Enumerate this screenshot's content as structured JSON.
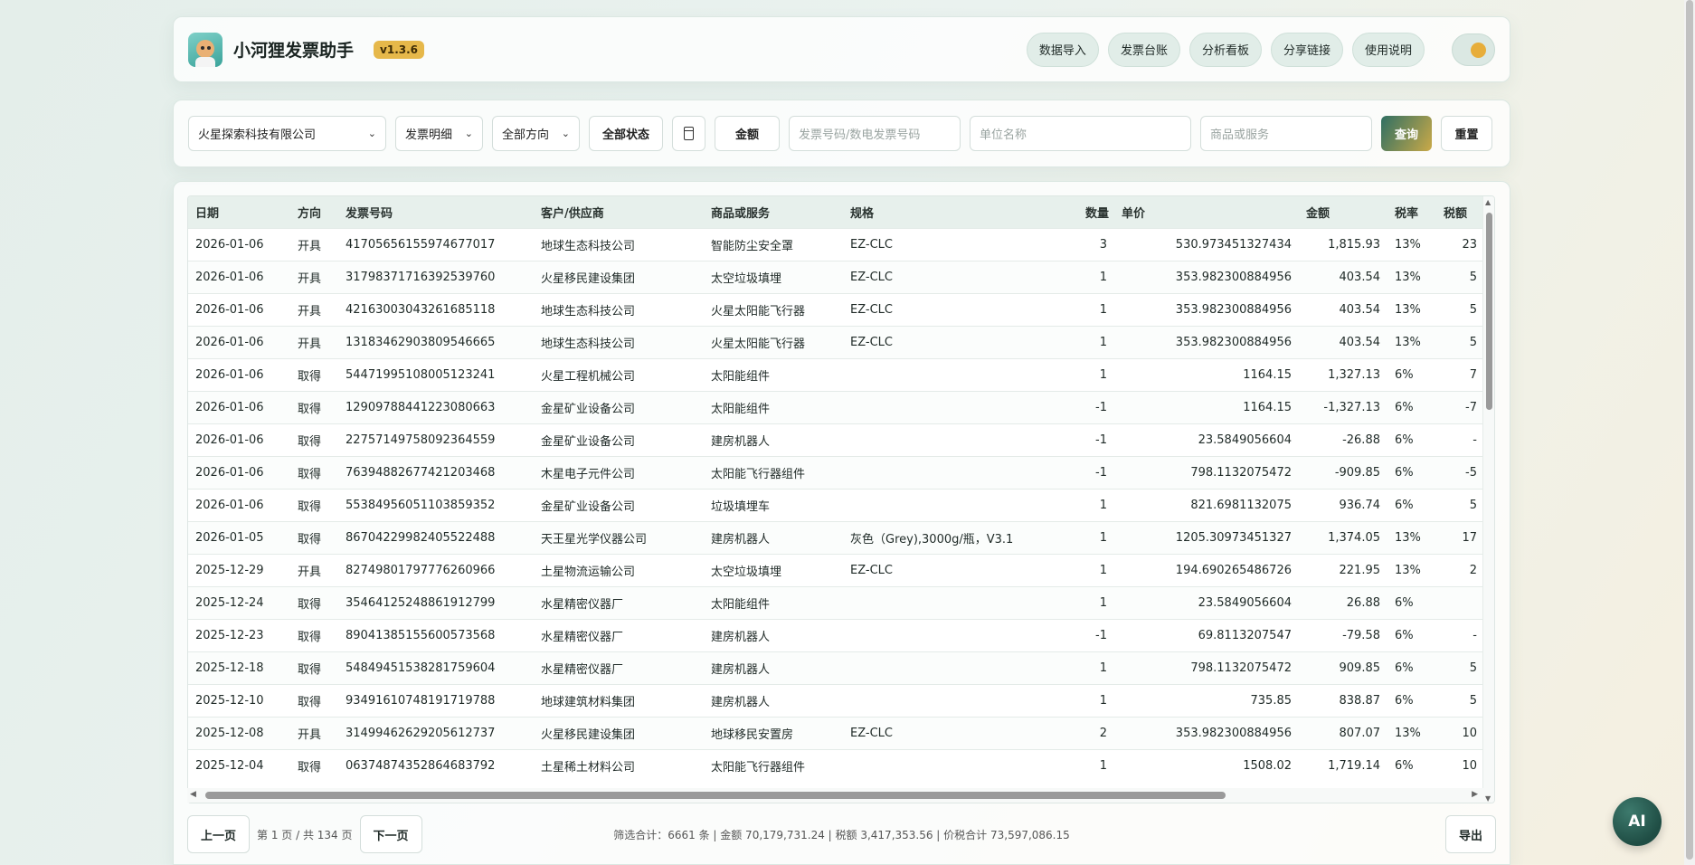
{
  "header": {
    "title": "小河狸发票助手",
    "version": "v1.3.6",
    "nav": [
      "数据导入",
      "发票台账",
      "分析看板",
      "分享链接",
      "使用说明"
    ]
  },
  "filters": {
    "company": "火星探索科技有限公司",
    "view": "发票明细",
    "direction": "全部方向",
    "status": "全部状态",
    "amount": "金额",
    "invoice_placeholder": "发票号码/数电发票号码",
    "unit_placeholder": "单位名称",
    "goods_placeholder": "商品或服务",
    "query": "查询",
    "reset": "重置"
  },
  "table": {
    "columns": [
      "日期",
      "方向",
      "发票号码",
      "客户/供应商",
      "商品或服务",
      "规格",
      "数量",
      "单价",
      "金额",
      "税率",
      "税额"
    ],
    "rows": [
      [
        "2026-01-06",
        "开具",
        "41705656155974677017",
        "地球生态科技公司",
        "智能防尘安全罩",
        "EZ-CLC",
        "3",
        "530.973451327434",
        "1,815.93",
        "13%",
        "23"
      ],
      [
        "2026-01-06",
        "开具",
        "31798371716392539760",
        "火星移民建设集团",
        "太空垃圾填埋",
        "EZ-CLC",
        "1",
        "353.982300884956",
        "403.54",
        "13%",
        "5"
      ],
      [
        "2026-01-06",
        "开具",
        "42163003043261685118",
        "地球生态科技公司",
        "火星太阳能飞行器",
        "EZ-CLC",
        "1",
        "353.982300884956",
        "403.54",
        "13%",
        "5"
      ],
      [
        "2026-01-06",
        "开具",
        "13183462903809546665",
        "地球生态科技公司",
        "火星太阳能飞行器",
        "EZ-CLC",
        "1",
        "353.982300884956",
        "403.54",
        "13%",
        "5"
      ],
      [
        "2026-01-06",
        "取得",
        "54471995108005123241",
        "火星工程机械公司",
        "太阳能组件",
        "",
        "1",
        "1164.15",
        "1,327.13",
        "6%",
        "7"
      ],
      [
        "2026-01-06",
        "取得",
        "12909788441223080663",
        "金星矿业设备公司",
        "太阳能组件",
        "",
        "-1",
        "1164.15",
        "-1,327.13",
        "6%",
        "-7"
      ],
      [
        "2026-01-06",
        "取得",
        "22757149758092364559",
        "金星矿业设备公司",
        "建房机器人",
        "",
        "-1",
        "23.5849056604",
        "-26.88",
        "6%",
        "-"
      ],
      [
        "2026-01-06",
        "取得",
        "76394882677421203468",
        "木星电子元件公司",
        "太阳能飞行器组件",
        "",
        "-1",
        "798.1132075472",
        "-909.85",
        "6%",
        "-5"
      ],
      [
        "2026-01-06",
        "取得",
        "55384956051103859352",
        "金星矿业设备公司",
        "垃圾填埋车",
        "",
        "1",
        "821.6981132075",
        "936.74",
        "6%",
        "5"
      ],
      [
        "2026-01-05",
        "取得",
        "86704229982405522488",
        "天王星光学仪器公司",
        "建房机器人",
        "灰色（Grey),3000g/瓶，V3.1",
        "1",
        "1205.30973451327",
        "1,374.05",
        "13%",
        "17"
      ],
      [
        "2025-12-29",
        "开具",
        "82749801797776260966",
        "土星物流运输公司",
        "太空垃圾填埋",
        "EZ-CLC",
        "1",
        "194.690265486726",
        "221.95",
        "13%",
        "2"
      ],
      [
        "2025-12-24",
        "取得",
        "35464125248861912799",
        "水星精密仪器厂",
        "太阳能组件",
        "",
        "1",
        "23.5849056604",
        "26.88",
        "6%",
        ""
      ],
      [
        "2025-12-23",
        "取得",
        "89041385155600573568",
        "水星精密仪器厂",
        "建房机器人",
        "",
        "-1",
        "69.8113207547",
        "-79.58",
        "6%",
        "-"
      ],
      [
        "2025-12-18",
        "取得",
        "54849451538281759604",
        "水星精密仪器厂",
        "建房机器人",
        "",
        "1",
        "798.1132075472",
        "909.85",
        "6%",
        "5"
      ],
      [
        "2025-12-10",
        "取得",
        "93491610748191719788",
        "地球建筑材料集团",
        "建房机器人",
        "",
        "1",
        "735.85",
        "838.87",
        "6%",
        "5"
      ],
      [
        "2025-12-08",
        "开具",
        "31499462629205612737",
        "火星移民建设集团",
        "地球移民安置房",
        "EZ-CLC",
        "2",
        "353.982300884956",
        "807.07",
        "13%",
        "10"
      ],
      [
        "2025-12-04",
        "取得",
        "06374874352864683792",
        "土星稀土材料公司",
        "太阳能飞行器组件",
        "",
        "1",
        "1508.02",
        "1,719.14",
        "6%",
        "10"
      ]
    ]
  },
  "footer": {
    "prev": "上一页",
    "page_info": "第 1 页 / 共 134 页",
    "next": "下一页",
    "summary": "筛选合计：6661 条 | 金额 70,179,731.24 | 税额 3,417,353.56 | 价税合计 73,597,086.15",
    "export": "导出"
  },
  "ai_button": "AI",
  "colors": {
    "accent": "#2f6f63",
    "version_badge": "#e6b84a",
    "toggle_knob": "#e7ad3a"
  },
  "icons": [
    "logo-beaver-icon",
    "chevron-down-icon",
    "calendar-icon"
  ]
}
